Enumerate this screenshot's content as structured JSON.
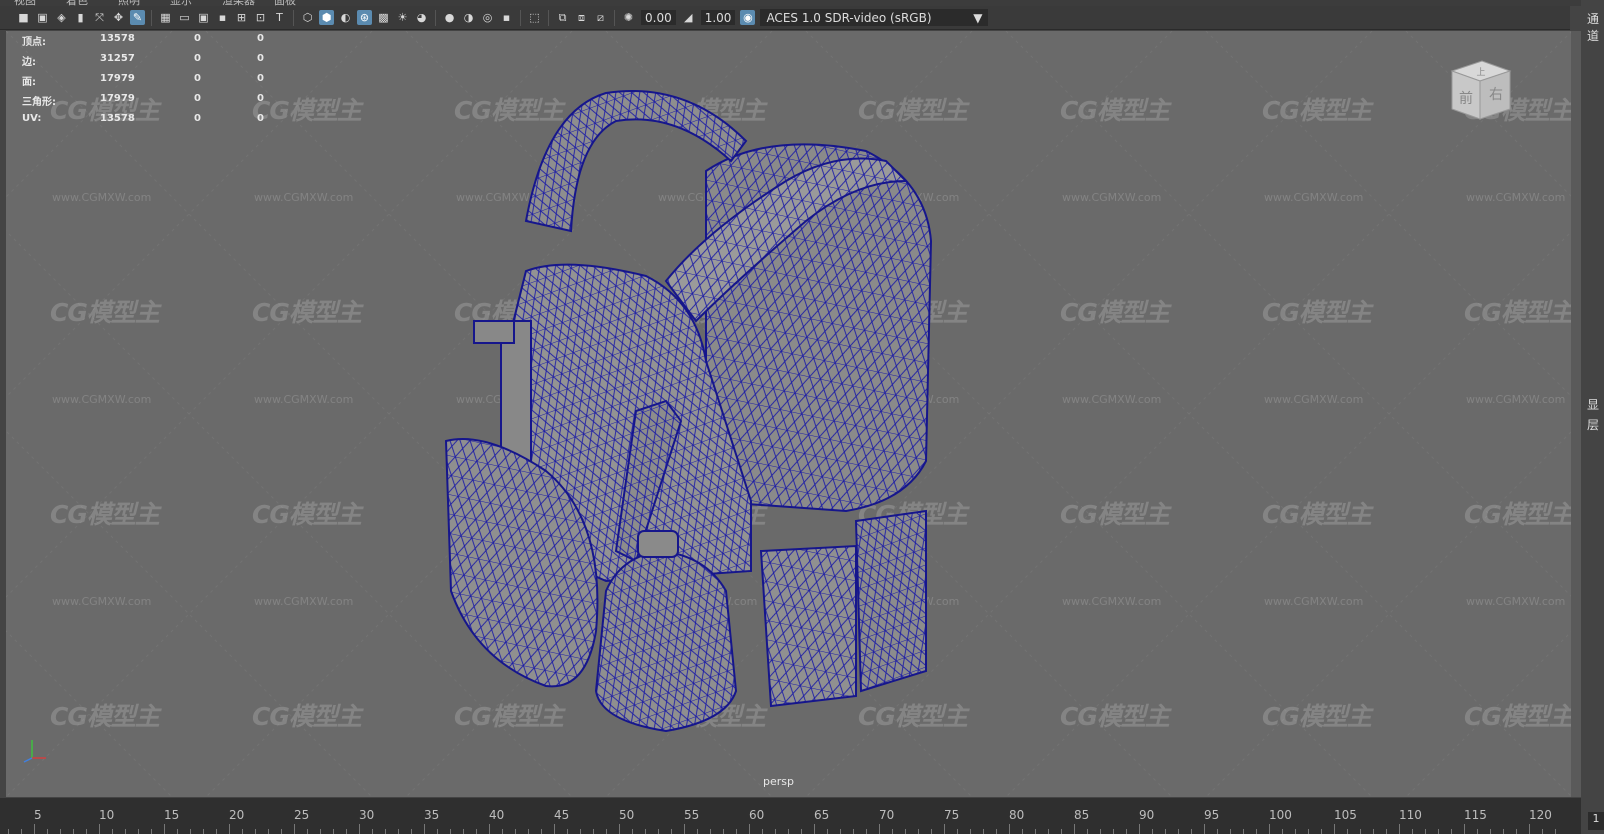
{
  "menu": [
    "视图",
    "着色",
    "照明",
    "显示",
    "渲染器",
    "面板"
  ],
  "toolbar": {
    "exposure": "0.00",
    "gamma": "1.00",
    "colorspace": "ACES 1.0 SDR-video (sRGB)"
  },
  "hud": {
    "rows": [
      {
        "label": "顶点:",
        "value": "13578",
        "a": "0",
        "b": "0"
      },
      {
        "label": "边:",
        "value": "31257",
        "a": "0",
        "b": "0"
      },
      {
        "label": "面:",
        "value": "17979",
        "a": "0",
        "b": "0"
      },
      {
        "label": "三角形:",
        "value": "17979",
        "a": "0",
        "b": "0"
      },
      {
        "label": "UV:",
        "value": "13578",
        "a": "0",
        "b": "0"
      }
    ]
  },
  "watermark": {
    "logo": "CG模型主",
    "url": "www.CGMXW.com"
  },
  "viewport": {
    "camera": "persp"
  },
  "viewcube": {
    "top": "上",
    "front": "前",
    "right": "右"
  },
  "right_panel": {
    "tab1": "通道",
    "tab2": "显",
    "tab3": "层"
  },
  "timeline": {
    "ticks": [
      "5",
      "10",
      "15",
      "20",
      "25",
      "30",
      "35",
      "40",
      "45",
      "50",
      "55",
      "60",
      "65",
      "70",
      "75",
      "80",
      "85",
      "90",
      "95",
      "100",
      "105",
      "110",
      "115",
      "120"
    ],
    "current_frame": "1"
  },
  "colors": {
    "wire": "#1a1aa0",
    "viewport_bg": "#6a6a6a",
    "model": "#8c8c8c"
  }
}
